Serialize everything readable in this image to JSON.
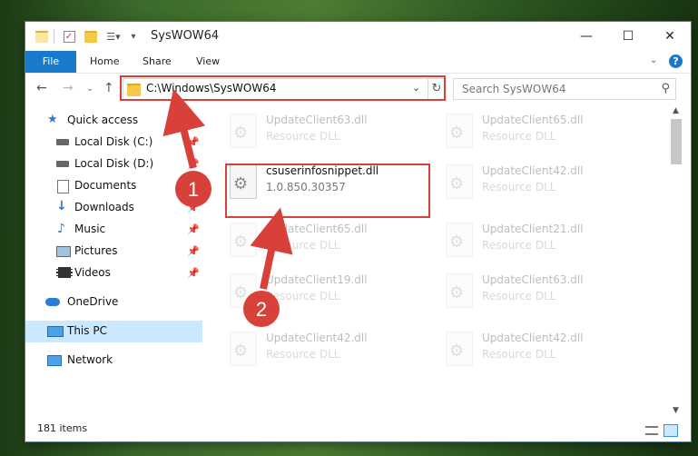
{
  "window": {
    "title": "SysWOW64",
    "controls": {
      "minimize": "—",
      "maximize": "☐",
      "close": "✕"
    }
  },
  "ribbon": {
    "tabs": [
      "File",
      "Home",
      "Share",
      "View"
    ],
    "help": "?"
  },
  "navigation": {
    "address": "C:\\Windows\\SysWOW64",
    "search_placeholder": "Search SysWOW64"
  },
  "sidebar": {
    "items": [
      {
        "label": "Quick access",
        "icon": "star-icon",
        "pinned": false
      },
      {
        "label": "Local Disk (C:)",
        "icon": "drive-icon",
        "pinned": true
      },
      {
        "label": "Local Disk (D:)",
        "icon": "drive-icon",
        "pinned": true
      },
      {
        "label": "Documents",
        "icon": "document-icon",
        "pinned": true
      },
      {
        "label": "Downloads",
        "icon": "download-icon",
        "pinned": true
      },
      {
        "label": "Music",
        "icon": "music-icon",
        "pinned": true
      },
      {
        "label": "Pictures",
        "icon": "pictures-icon",
        "pinned": true
      },
      {
        "label": "Videos",
        "icon": "video-icon",
        "pinned": true
      },
      {
        "label": "OneDrive",
        "icon": "cloud-icon",
        "pinned": false
      },
      {
        "label": "This PC",
        "icon": "computer-icon",
        "pinned": false,
        "selected": true
      },
      {
        "label": "Network",
        "icon": "network-icon",
        "pinned": false
      }
    ]
  },
  "files": [
    {
      "name": "UpdateClient63.dll",
      "sub": "Resource DLL",
      "faded": true
    },
    {
      "name": "UpdateClient65.dll",
      "sub": "Resource DLL",
      "faded": true
    },
    {
      "name": "csuserinfosnippet.dll",
      "sub": "1.0.850.30357",
      "faded": false
    },
    {
      "name": "UpdateClient42.dll",
      "sub": "Resource DLL",
      "faded": true
    },
    {
      "name": "UpdateClient65.dll",
      "sub": "Resource DLL",
      "faded": true
    },
    {
      "name": "UpdateClient21.dll",
      "sub": "Resource DLL",
      "faded": true
    },
    {
      "name": "UpdateClient19.dll",
      "sub": "Resource DLL",
      "faded": true
    },
    {
      "name": "UpdateClient63.dll",
      "sub": "Resource DLL",
      "faded": true
    },
    {
      "name": "UpdateClient42.dll",
      "sub": "Resource DLL",
      "faded": true
    },
    {
      "name": "UpdateClient42.dll",
      "sub": "Resource DLL",
      "faded": true
    }
  ],
  "status": {
    "item_count": "181 items"
  },
  "annotations": {
    "step1": "1",
    "step2": "2",
    "color": "#d8413a"
  }
}
